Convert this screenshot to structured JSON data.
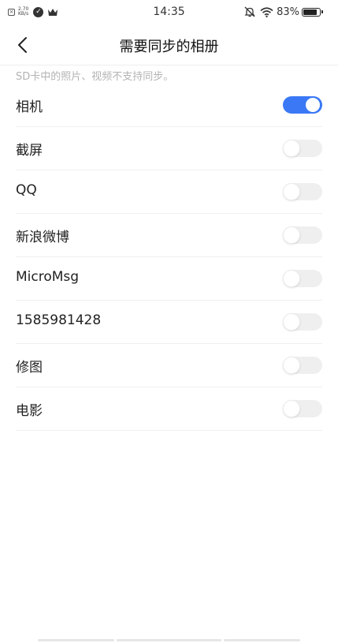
{
  "status_bar": {
    "speed_value": "2.70",
    "speed_unit": "KB/s",
    "time": "14:35",
    "battery_pct": "83%",
    "icons": [
      "sim-icon",
      "check-icon",
      "crown-icon",
      "mute-icon",
      "wifi-icon",
      "battery-icon"
    ]
  },
  "header": {
    "back_icon": "chevron-left-icon",
    "title": "需要同步的相册"
  },
  "note": "SD卡中的照片、视频不支持同步。",
  "albums": [
    {
      "name": "相机",
      "enabled": true
    },
    {
      "name": "截屏",
      "enabled": false
    },
    {
      "name": "QQ",
      "enabled": false
    },
    {
      "name": "新浪微博",
      "enabled": false
    },
    {
      "name": "MicroMsg",
      "enabled": false
    },
    {
      "name": "1585981428",
      "enabled": false
    },
    {
      "name": "修图",
      "enabled": false
    },
    {
      "name": "电影",
      "enabled": false
    }
  ],
  "colors": {
    "toggle_on": "#3a78f5",
    "toggle_off": "#efefef",
    "note_text": "#b3b3b3"
  }
}
